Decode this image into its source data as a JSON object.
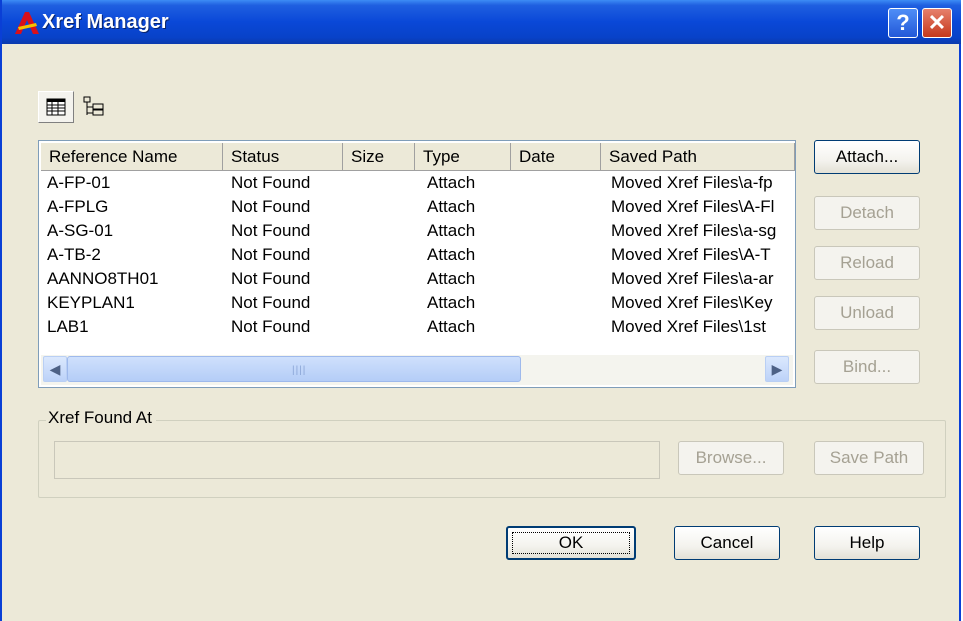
{
  "window": {
    "title": "Xref Manager",
    "help_glyph": "?",
    "close_glyph": "✕"
  },
  "toolbar": {
    "list_view_icon": "list-view-icon",
    "tree_view_icon": "tree-view-icon"
  },
  "columns": [
    "Reference Name",
    "Status",
    "Size",
    "Type",
    "Date",
    "Saved Path"
  ],
  "rows": [
    [
      "A-FP-01",
      "Not Found",
      "",
      "Attach",
      "",
      "Moved Xref Files\\a-fp"
    ],
    [
      "A-FPLG",
      "Not Found",
      "",
      "Attach",
      "",
      "Moved Xref Files\\A-Fl"
    ],
    [
      "A-SG-01",
      "Not Found",
      "",
      "Attach",
      "",
      "Moved Xref Files\\a-sg"
    ],
    [
      "A-TB-2",
      "Not Found",
      "",
      "Attach",
      "",
      "Moved Xref Files\\A-T"
    ],
    [
      "AANNO8TH01",
      "Not Found",
      "",
      "Attach",
      "",
      "Moved Xref Files\\a-ar"
    ],
    [
      "KEYPLAN1",
      "Not Found",
      "",
      "Attach",
      "",
      "Moved Xref Files\\Key"
    ],
    [
      "LAB1",
      "Not Found",
      "",
      "Attach",
      "",
      "Moved Xref Files\\1st"
    ]
  ],
  "side_buttons": {
    "attach": "Attach...",
    "detach": "Detach",
    "reload": "Reload",
    "unload": "Unload",
    "bind": "Bind..."
  },
  "found_at": {
    "label": "Xref Found At",
    "value": "",
    "browse": "Browse...",
    "save_path": "Save Path"
  },
  "footer": {
    "ok": "OK",
    "cancel": "Cancel",
    "help": "Help"
  },
  "colors": {
    "titlebar": "#0a48d8",
    "dialog_bg": "#ece9d8",
    "disabled_text": "#a5a193"
  }
}
